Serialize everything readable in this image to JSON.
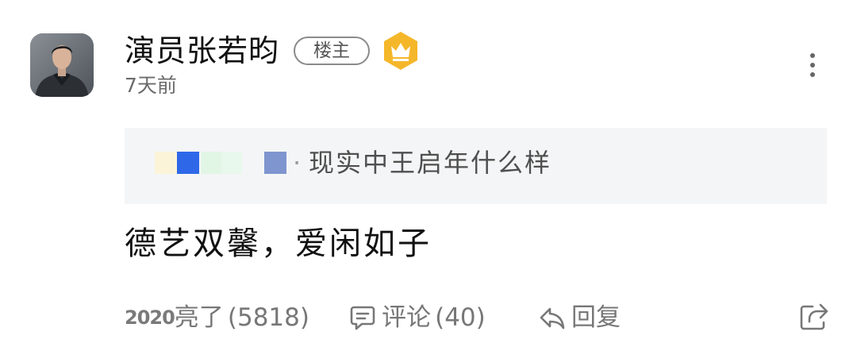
{
  "post": {
    "author": {
      "name": "演员张若昀",
      "op_badge": "楼主",
      "crown_color": "#f5b72a",
      "avatar_bg": "#6f767d"
    },
    "time": "7天前",
    "quoted": {
      "separator": "·",
      "text": "现实中王启年什么样",
      "mosaic_colors": [
        "#fbf4d8",
        "#2e68e8",
        "#e2f6e6",
        "#e8f8ec",
        "#7f95cf"
      ]
    },
    "content": "德艺双馨，爱闲如子"
  },
  "actions": {
    "like": {
      "prefix": "2020",
      "label": "亮了",
      "count": "(5818)"
    },
    "comment": {
      "icon": "comment-icon",
      "label": "评论",
      "count": "(40)"
    },
    "reply": {
      "icon": "reply-icon",
      "label": "回复"
    },
    "share": {
      "icon": "share-icon"
    },
    "more": {
      "icon": "more-vertical-icon"
    }
  }
}
